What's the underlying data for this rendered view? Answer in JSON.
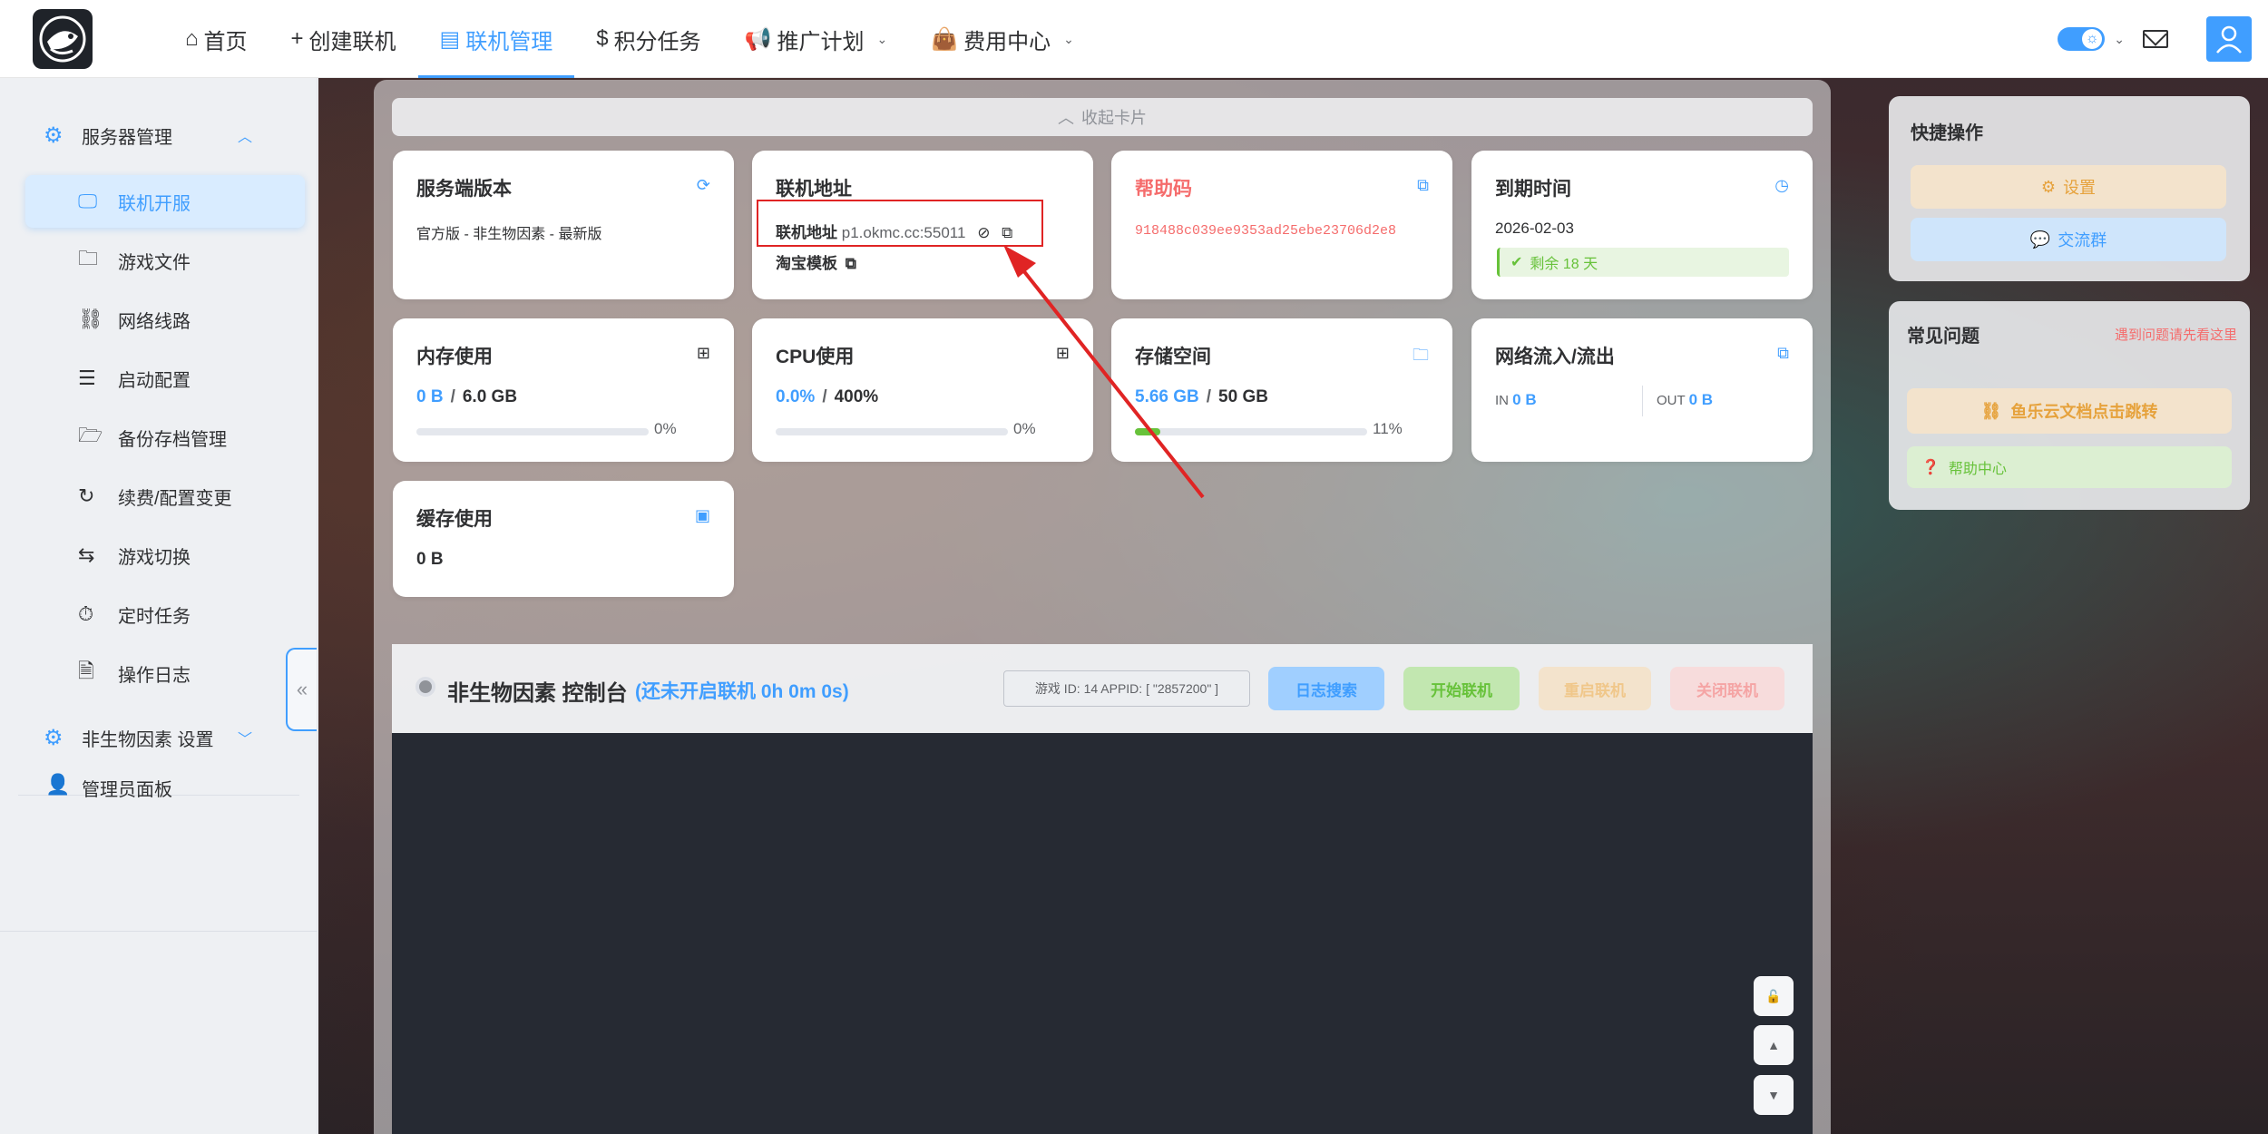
{
  "nav": {
    "items": [
      {
        "icon": "home-icon",
        "glyph": "⌂",
        "label": "首页"
      },
      {
        "icon": "plus-icon",
        "glyph": "+",
        "label": "创建联机"
      },
      {
        "icon": "server-icon",
        "glyph": "▤",
        "label": "联机管理"
      },
      {
        "icon": "dollar-icon",
        "glyph": "$",
        "label": "积分任务"
      },
      {
        "icon": "megaphone-icon",
        "glyph": "📢",
        "label": "推广计划"
      },
      {
        "icon": "bag-icon",
        "glyph": "👜",
        "label": "费用中心"
      }
    ],
    "active": "联机管理"
  },
  "sidebar": {
    "group1": "服务器管理",
    "items": [
      "联机开服",
      "游戏文件",
      "网络线路",
      "启动配置",
      "备份存档管理",
      "续费/配置变更",
      "游戏切换",
      "定时任务",
      "操作日志"
    ],
    "group2": "非生物因素 设置",
    "admin": "管理员面板",
    "collapse": "«"
  },
  "collapse_cards": "收起卡片",
  "cards": {
    "version": {
      "title": "服务端版本",
      "value": "官方版 - 非生物因素 - 最新版"
    },
    "address": {
      "title": "联机地址",
      "label": "联机地址",
      "value": "p1.okmc.cc:55011",
      "template_label": "淘宝模板"
    },
    "help": {
      "title": "帮助码",
      "value": "918488c039ee9353ad25ebe23706d2e8"
    },
    "expire": {
      "title": "到期时间",
      "date": "2026-02-03",
      "remaining": "剩余 18 天"
    },
    "memory": {
      "title": "内存使用",
      "used": "0 B",
      "total": "6.0 GB",
      "percent": "0%",
      "fraction": 0.0
    },
    "cpu": {
      "title": "CPU使用",
      "used": "0.0%",
      "total": "400%",
      "percent": "0%",
      "fraction": 0.0
    },
    "storage": {
      "title": "存储空间",
      "used": "5.66 GB",
      "total": "50 GB",
      "percent": "11%",
      "fraction": 0.11
    },
    "network": {
      "title": "网络流入/流出",
      "in_label": "IN",
      "in_value": "0 B",
      "out_label": "OUT",
      "out_value": "0 B"
    },
    "cache": {
      "title": "缓存使用",
      "value": "0 B"
    }
  },
  "console": {
    "title": "非生物因素 控制台",
    "status": "(还未开启联机 0h 0m 0s)",
    "id_info": "游戏 ID: 14   APPID: [ \"2857200\" ]",
    "buttons": {
      "log": "日志搜索",
      "start": "开始联机",
      "restart": "重启联机",
      "stop": "关闭联机"
    }
  },
  "quick": {
    "title": "快捷操作",
    "settings": "设置",
    "group": "交流群"
  },
  "faq": {
    "title": "常见问题",
    "hint": "遇到问题请先看这里",
    "docs": "鱼乐云文档点击跳转",
    "help_center": "帮助中心"
  },
  "colors": {
    "accent": "#409eff",
    "danger": "#f56c6c",
    "success": "#67c23a",
    "warning": "#e6a23c"
  }
}
